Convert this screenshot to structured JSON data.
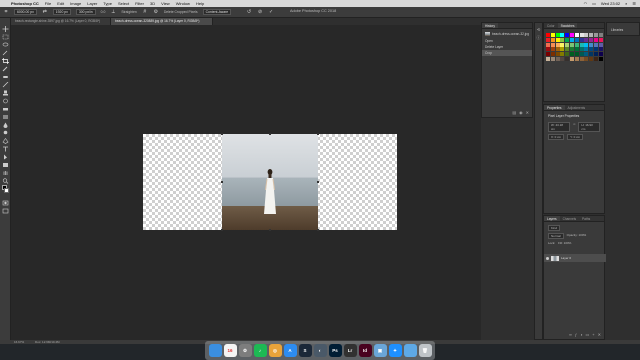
{
  "menubar": {
    "app_name": "Photoshop CC",
    "items": [
      "File",
      "Edit",
      "Image",
      "Layer",
      "Type",
      "Select",
      "Filter",
      "3D",
      "View",
      "Window",
      "Help"
    ],
    "clock": "Wed 23:02"
  },
  "window_title": "Adobe Photoshop CC 2018",
  "options": {
    "w_label": "W:",
    "w_value": "6000.00 px",
    "h_label": "H:",
    "h_value": "1920 px",
    "res_value": "300 px/in",
    "angle_value": "0.0",
    "straighten_label": "Straighten",
    "grid_label": "Grid",
    "delete_label": "Delete Cropped Pixels",
    "mode_label": "Content-Aware"
  },
  "tabs": [
    {
      "label": "beach-rectangle-shine-3597.jpg @ 16.7% (Layer 0, RGB/8*)"
    },
    {
      "label": "beach-dress-ocean-320889.jpg @ 16.7% (Layer 0, RGB/8*)"
    }
  ],
  "history": {
    "tabs": [
      "History"
    ],
    "items": [
      {
        "label": "beach-dress-ocean-32.jpg"
      },
      {
        "label": "Open"
      },
      {
        "label": "Delete Layer"
      },
      {
        "label": "Crop"
      }
    ]
  },
  "swatches": {
    "tabs": [
      "Color",
      "Swatches"
    ],
    "colors": [
      "#ff0000",
      "#ffff00",
      "#00ff00",
      "#00ffff",
      "#0000ff",
      "#ff00ff",
      "#ffffff",
      "#e5e5e5",
      "#cccccc",
      "#b3b3b3",
      "#999999",
      "#808080",
      "#ed1c24",
      "#f7941d",
      "#fff200",
      "#8dc63f",
      "#00a651",
      "#00aeef",
      "#0072bc",
      "#2e3192",
      "#662d91",
      "#92278f",
      "#ec008c",
      "#ed145b",
      "#f26c4f",
      "#f68e55",
      "#fbaf5c",
      "#fff467",
      "#acd372",
      "#7cc576",
      "#3bb878",
      "#1abbb4",
      "#00bff3",
      "#438ccb",
      "#5574b9",
      "#605ca8",
      "#9e0b0f",
      "#a0410d",
      "#a3620a",
      "#aba000",
      "#598527",
      "#1a7b30",
      "#007236",
      "#00746b",
      "#0076a3",
      "#004b80",
      "#003471",
      "#1b1464",
      "#790000",
      "#7b2e00",
      "#7d4900",
      "#827b00",
      "#406618",
      "#005e20",
      "#005826",
      "#005952",
      "#005b7f",
      "#003663",
      "#002157",
      "#0d004c",
      "#c7b299",
      "#998675",
      "#736357",
      "#534741",
      "#37302d",
      "#c69c6d",
      "#a67c52",
      "#8c6239",
      "#754c24",
      "#603913",
      "#3c2415",
      "#000000"
    ]
  },
  "libraries": {
    "label": "Libraries"
  },
  "properties": {
    "tabs": [
      "Properties",
      "Adjustments"
    ],
    "title": "Pixel Layer Properties",
    "w": "W: 43.18 cm",
    "h": "H: 16.93 cm",
    "x": "X: 0 cm",
    "y": "Y: 0 cm"
  },
  "layers": {
    "tabs": [
      "Layers",
      "Channels",
      "Paths"
    ],
    "kind": "Kind",
    "blend": "Normal",
    "opacity": "Opacity: 100%",
    "lock": "Lock:",
    "fill": "Fill: 100%",
    "items": [
      {
        "name": "Layer 0"
      }
    ]
  },
  "status": {
    "zoom": "16.67%",
    "doc": "Doc: 12.6M/10.4M"
  },
  "dock": {
    "apps": [
      {
        "name": "finder-icon",
        "color": "#3b8fe0",
        "glyph": ""
      },
      {
        "name": "calendar-icon",
        "color": "#f4f4f4",
        "glyph": "16"
      },
      {
        "name": "system-preferences-icon",
        "color": "#7d7d7d",
        "glyph": "⚙"
      },
      {
        "name": "spotify-icon",
        "color": "#1db954",
        "glyph": "♪"
      },
      {
        "name": "chrome-icon",
        "color": "#e8a33a",
        "glyph": "◎"
      },
      {
        "name": "app-store-icon",
        "color": "#2d8cf0",
        "glyph": "A"
      },
      {
        "name": "steam-icon",
        "color": "#1b2838",
        "glyph": "S"
      },
      {
        "name": "davinci-icon",
        "color": "#4a5968",
        "glyph": "◐"
      },
      {
        "name": "photoshop-icon",
        "color": "#001d34",
        "glyph": "Ps"
      },
      {
        "name": "lightroom-icon",
        "color": "#313131",
        "glyph": "Lr"
      },
      {
        "name": "indesign-icon",
        "color": "#49021f",
        "glyph": "Id"
      },
      {
        "name": "preview-icon",
        "color": "#6aa6d8",
        "glyph": "▣"
      },
      {
        "name": "safari-icon",
        "color": "#1e90ff",
        "glyph": "✦"
      },
      {
        "name": "folder-icon",
        "color": "#5ea9e6",
        "glyph": ""
      },
      {
        "name": "trash-icon",
        "color": "#bfc4c8",
        "glyph": "🗑"
      }
    ]
  }
}
